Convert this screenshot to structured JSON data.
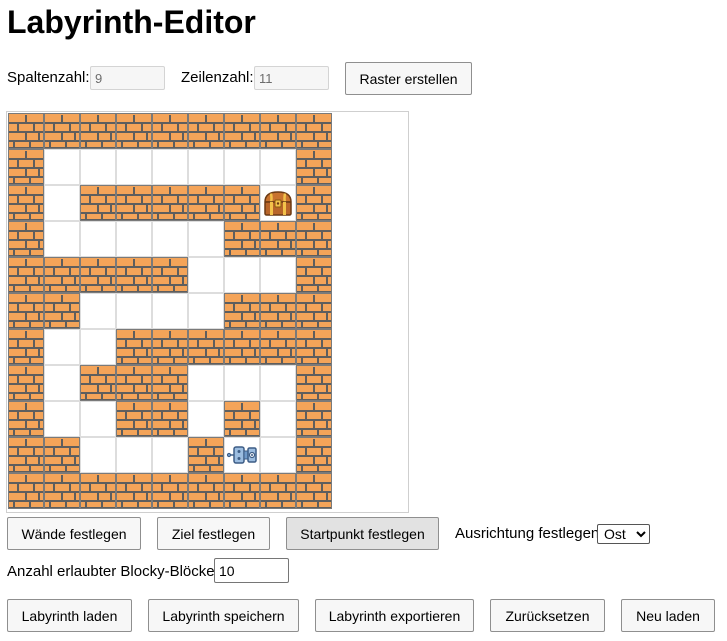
{
  "title": "Labyrinth-Editor",
  "grid_settings": {
    "columns_label": "Spaltenzahl:",
    "columns_value": "9",
    "rows_label": "Zeilenzahl:",
    "rows_value": "11",
    "create_button": "Raster erstellen"
  },
  "maze": {
    "columns": 9,
    "rows": 11,
    "cells": [
      "#########",
      "#.......#",
      "#.#####G#",
      "#.....###",
      "#####...#",
      "##....###",
      "#..######",
      "#.###...#",
      "#..##.#.#",
      "##...#S.#",
      "#########"
    ],
    "legend": {
      "#": "wall",
      ".": "floor",
      "G": "goal",
      "S": "start"
    },
    "goal_icon": "treasure-chest-icon",
    "start_icon": "robot-icon",
    "wall_color": "#f4a459",
    "mortar_color": "#5e5e5e"
  },
  "edit_controls": {
    "walls_button": "Wände festlegen",
    "goal_button": "Ziel festlegen",
    "start_button": "Startpunkt festlegen",
    "active_mode": "start",
    "orientation_label": "Ausrichtung festlegen:",
    "orientation_value": "Ost"
  },
  "blocks": {
    "label": "Anzahl erlaubter Blocky-Blöcke:",
    "value": "10"
  },
  "actions": {
    "load": "Labyrinth laden",
    "save": "Labyrinth speichern",
    "export": "Labyrinth exportieren",
    "reset": "Zurücksetzen",
    "reload": "Neu laden"
  }
}
